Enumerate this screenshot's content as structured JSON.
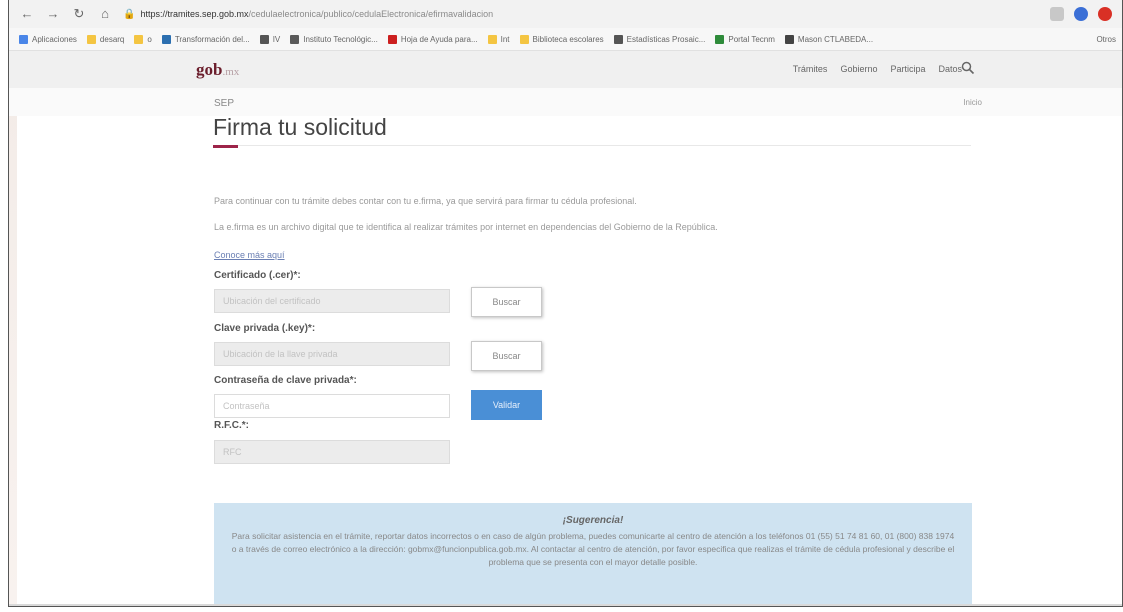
{
  "browser": {
    "url_host": "https://tramites.sep.gob.mx",
    "url_path": "/cedulaelectronica/publico/cedulaElectronica/efirmavalidacion",
    "bookmarks": [
      {
        "label": "Aplicaciones",
        "color": "#4a86e8"
      },
      {
        "label": "desarq",
        "color": "#f4c542"
      },
      {
        "label": "o",
        "color": "#f4c542"
      },
      {
        "label": "Transformación del...",
        "color": "#2c6fb0"
      },
      {
        "label": "IV",
        "color": "#555555"
      },
      {
        "label": "Instituto Tecnológic...",
        "color": "#5a5a5a"
      },
      {
        "label": "Hoja de Ayuda para...",
        "color": "#cc1f1f"
      },
      {
        "label": "Int",
        "color": "#f4c542"
      },
      {
        "label": "Biblioteca escolares",
        "color": "#f4c542"
      },
      {
        "label": "Estadísticas Prosaic...",
        "color": "#555555"
      },
      {
        "label": "Portal Tecnm",
        "color": "#2e8b3a"
      },
      {
        "label": "Mason CTLABEDA...",
        "color": "#444444"
      }
    ],
    "bookmarks_other": "Otros"
  },
  "header": {
    "logo_main": "gob",
    "logo_suffix": ".mx",
    "nav": [
      "Trámites",
      "Gobierno",
      "Participa",
      "Datos"
    ]
  },
  "breadcrumb": {
    "current": "SEP",
    "home": "Inicio"
  },
  "page": {
    "title": "Firma tu solicitud",
    "para1": "Para continuar con tu trámite debes contar con tu e.firma, ya que servirá para firmar tu cédula profesional.",
    "para2": "La e.firma es un archivo digital que te identifica al realizar trámites por internet en dependencias del Gobierno de la República.",
    "link": "Conoce más aquí"
  },
  "form": {
    "cert_label": "Certificado (.cer)*:",
    "cert_placeholder": "Ubicación del certificado",
    "key_label": "Clave privada (.key)*:",
    "key_placeholder": "Ubicación de la llave privada",
    "pass_label": "Contraseña de clave privada*:",
    "pass_placeholder": "Contraseña",
    "rfc_label": "R.F.C.*:",
    "rfc_placeholder": "RFC",
    "buscar": "Buscar",
    "validar": "Validar"
  },
  "suggestion": {
    "title": "¡Sugerencia!",
    "text": "Para solicitar asistencia en el trámite, reportar datos incorrectos o en caso de algún problema, puedes comunicarte al centro de atención a los teléfonos 01 (55) 51 74 81 60, 01 (800) 838 1974 o a través de correo electrónico a la dirección: gobmx@funcionpublica.gob.mx. Al contactar al centro de atención, por favor especifica que realizas el trámite de cédula profesional y describe el problema que se presenta con el mayor detalle posible."
  },
  "colors": {
    "brand": "#6b1e2c",
    "accent": "#9d2449",
    "button_primary": "#4a8fd6",
    "suggestion_bg": "#cfe3f1"
  }
}
